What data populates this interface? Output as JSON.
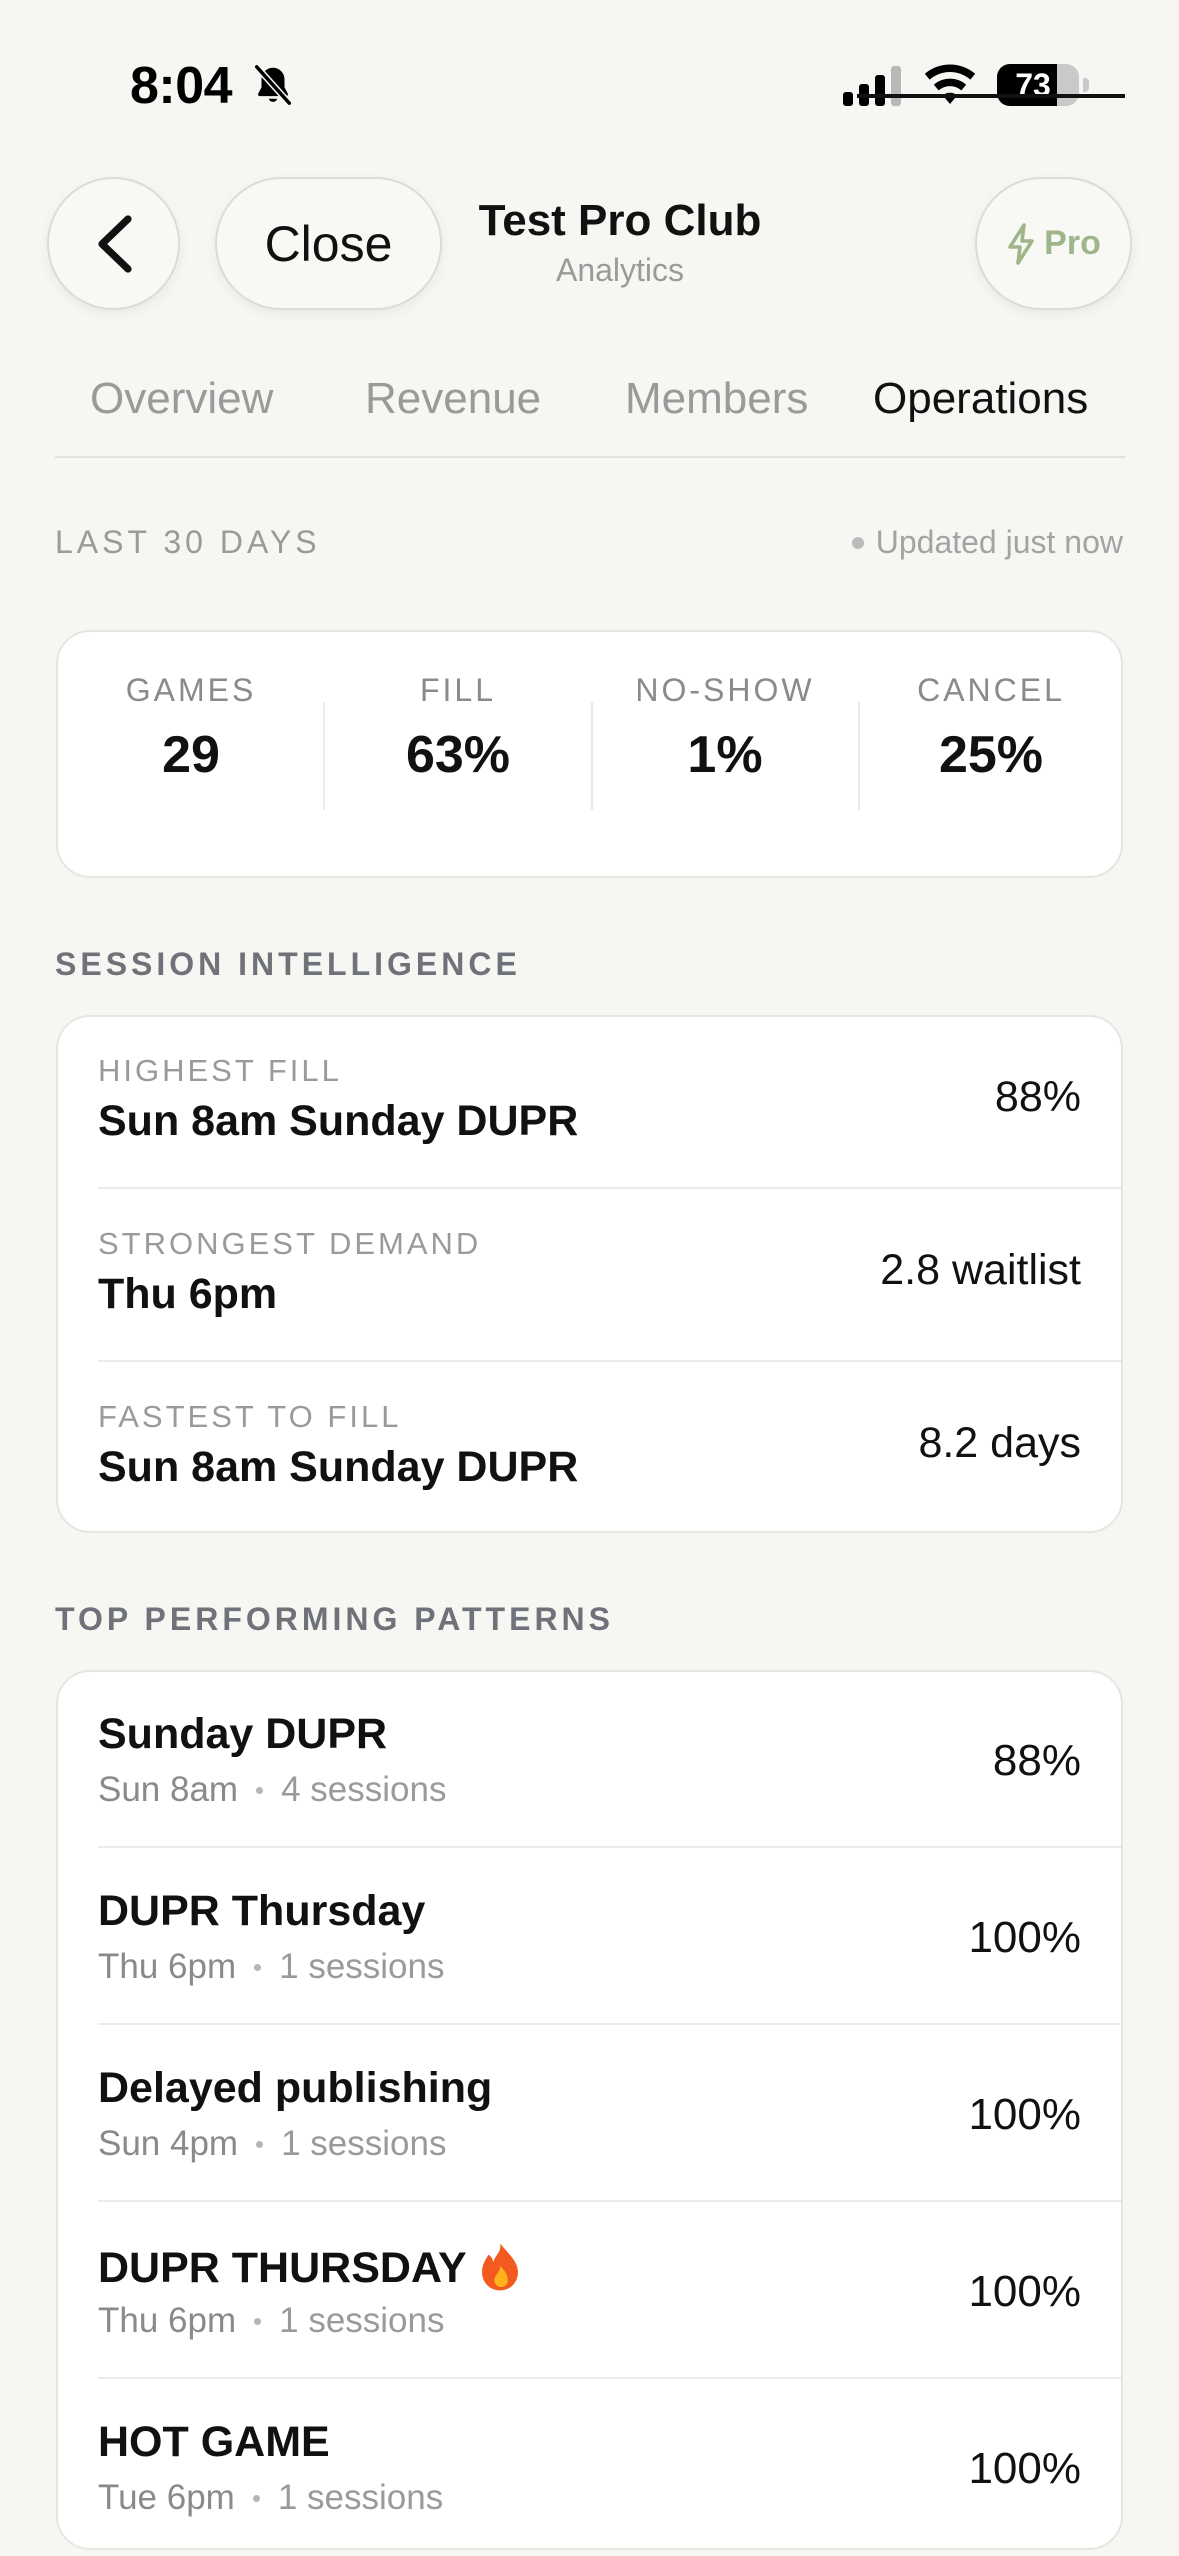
{
  "status_bar": {
    "time": "8:04",
    "battery": "73",
    "battery_level": 0.73,
    "icons": [
      "bell-slash-icon",
      "cellular-signal-icon",
      "wifi-icon",
      "battery-icon"
    ]
  },
  "header": {
    "close_label": "Close",
    "title": "Test Pro Club",
    "subtitle": "Analytics",
    "pro_label": "Pro",
    "pro_color": "#9fb58a"
  },
  "tabs": [
    {
      "label": "Overview",
      "active": false
    },
    {
      "label": "Revenue",
      "active": false
    },
    {
      "label": "Members",
      "active": false
    },
    {
      "label": "Operations",
      "active": true
    }
  ],
  "period": {
    "label": "LAST 30 DAYS",
    "updated": "Updated just now"
  },
  "stats": [
    {
      "label": "GAMES",
      "value": "29"
    },
    {
      "label": "FILL",
      "value": "63%"
    },
    {
      "label": "NO-SHOW",
      "value": "1%"
    },
    {
      "label": "CANCEL",
      "value": "25%"
    }
  ],
  "session_intelligence": {
    "heading": "SESSION INTELLIGENCE",
    "items": [
      {
        "label": "HIGHEST FILL",
        "title": "Sun 8am Sunday DUPR",
        "value": "88%"
      },
      {
        "label": "STRONGEST DEMAND",
        "title": "Thu 6pm",
        "value": "2.8 waitlist"
      },
      {
        "label": "FASTEST TO FILL",
        "title": "Sun 8am Sunday DUPR",
        "value": "8.2 days"
      }
    ]
  },
  "top_patterns": {
    "heading": "TOP PERFORMING PATTERNS",
    "items": [
      {
        "title": "Sunday DUPR",
        "time": "Sun 8am",
        "sessions": "4 sessions",
        "value": "88%",
        "hot": false
      },
      {
        "title": "DUPR Thursday",
        "time": "Thu 6pm",
        "sessions": "1 sessions",
        "value": "100%",
        "hot": false
      },
      {
        "title": "Delayed publishing",
        "time": "Sun 4pm",
        "sessions": "1 sessions",
        "value": "100%",
        "hot": false
      },
      {
        "title": "DUPR THURSDAY",
        "time": "Thu 6pm",
        "sessions": "1 sessions",
        "value": "100%",
        "hot": true
      },
      {
        "title": "HOT GAME",
        "time": "Tue 6pm",
        "sessions": "1 sessions",
        "value": "100%",
        "hot": false
      }
    ]
  }
}
